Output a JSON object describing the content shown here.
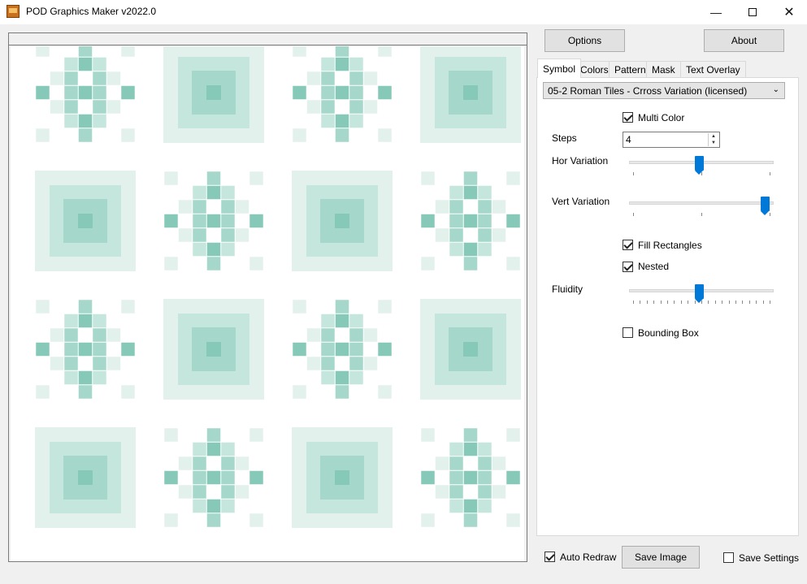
{
  "window": {
    "title": "POD Graphics Maker v2022.0",
    "minimize_icon": "minimize-icon",
    "maximize_icon": "maximize-icon",
    "close_icon": "close-icon"
  },
  "toolbar": {
    "options_label": "Options",
    "about_label": "About"
  },
  "tabs": [
    {
      "label": "Symbol",
      "active": true
    },
    {
      "label": "Colors",
      "active": false
    },
    {
      "label": "Pattern",
      "active": false
    },
    {
      "label": "Mask",
      "active": false
    },
    {
      "label": "Text Overlay",
      "active": false
    }
  ],
  "symbol": {
    "selected": "05-2 Roman Tiles - Crross Variation (licensed)",
    "multi_color": {
      "label": "Multi Color",
      "checked": true
    },
    "steps": {
      "label": "Steps",
      "value": "4"
    },
    "hor_variation": {
      "label": "Hor Variation",
      "value_fraction": 0.5
    },
    "vert_variation": {
      "label": "Vert Variation",
      "value_fraction": 1.0
    },
    "fill_rectangles": {
      "label": "Fill Rectangles",
      "checked": true
    },
    "nested": {
      "label": "Nested",
      "checked": true
    },
    "fluidity": {
      "label": "Fluidity",
      "value_fraction": 0.5
    },
    "bounding_box": {
      "label": "Bounding Box",
      "checked": false
    }
  },
  "footer": {
    "auto_redraw": {
      "label": "Auto Redraw",
      "checked": true
    },
    "save_image_label": "Save Image",
    "save_settings": {
      "label": "Save Settings",
      "checked": false
    }
  },
  "colors": {
    "tile_light": "#e3f1ed",
    "tile_mid1": "#c5e6dd",
    "tile_mid2": "#a5d8cb",
    "tile_dark": "#86c9b9",
    "accent": "#0078d7"
  },
  "pattern": {
    "columns": 4,
    "rows": 4,
    "first_tile": "cross"
  }
}
